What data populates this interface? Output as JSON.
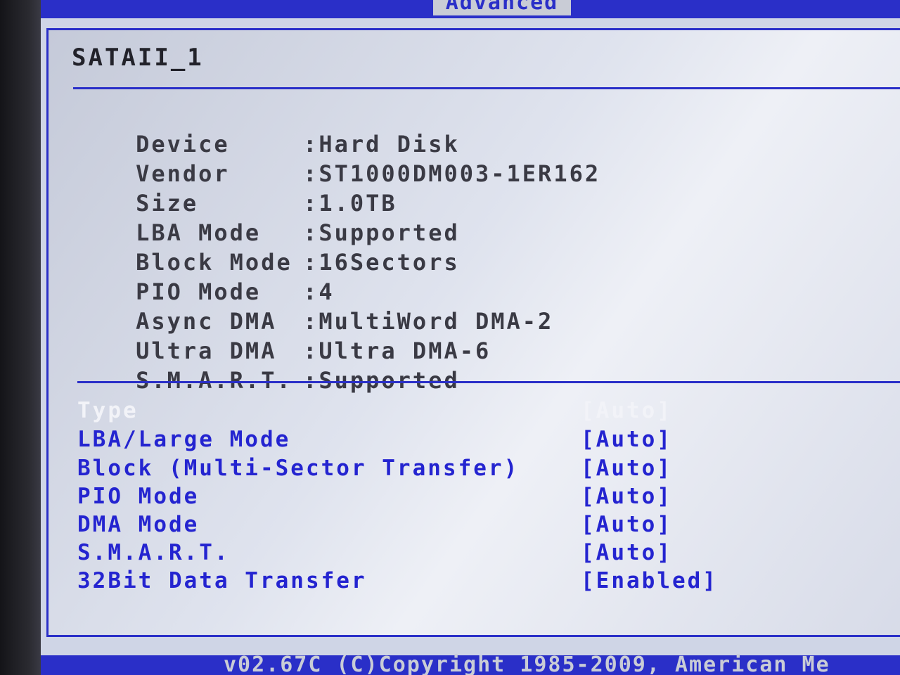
{
  "header": {
    "tab_label": "Advanced"
  },
  "panel": {
    "title": "SATAII_1",
    "info": [
      {
        "label": "Device",
        "sep": ":",
        "value": "Hard Disk"
      },
      {
        "label": "Vendor",
        "sep": ":",
        "value": "ST1000DM003-1ER162"
      },
      {
        "label": "Size",
        "sep": ":",
        "value": "1.0TB"
      },
      {
        "label": "LBA Mode",
        "sep": ":",
        "value": "Supported"
      },
      {
        "label": "Block Mode",
        "sep": ":",
        "value": "16Sectors"
      },
      {
        "label": "PIO Mode",
        "sep": ":",
        "value": "4"
      },
      {
        "label": "Async DMA",
        "sep": ":",
        "value": "MultiWord DMA-2"
      },
      {
        "label": "Ultra DMA",
        "sep": ":",
        "value": "Ultra DMA-6"
      },
      {
        "label": "S.M.A.R.T.",
        "sep": ":",
        "value": "Supported"
      }
    ],
    "options": [
      {
        "label": "Type",
        "value": "[Auto]",
        "selected": true
      },
      {
        "label": "LBA/Large Mode",
        "value": "[Auto]"
      },
      {
        "label": "Block (Multi-Sector Transfer)",
        "value": "[Auto]"
      },
      {
        "label": "PIO Mode",
        "value": "[Auto]"
      },
      {
        "label": "DMA Mode",
        "value": "[Auto]"
      },
      {
        "label": "S.M.A.R.T.",
        "value": "[Auto]"
      },
      {
        "label": "32Bit Data Transfer",
        "value": "[Enabled]"
      }
    ]
  },
  "footer": {
    "text": "v02.67C (C)Copyright 1985-2009, American Me"
  },
  "colors": {
    "bios_blue": "#2a2fc8",
    "panel_bg": "#dfe3ee",
    "option_text": "#2424d0",
    "info_text": "#3a3a44",
    "selected_text": "#f2f3f8"
  }
}
